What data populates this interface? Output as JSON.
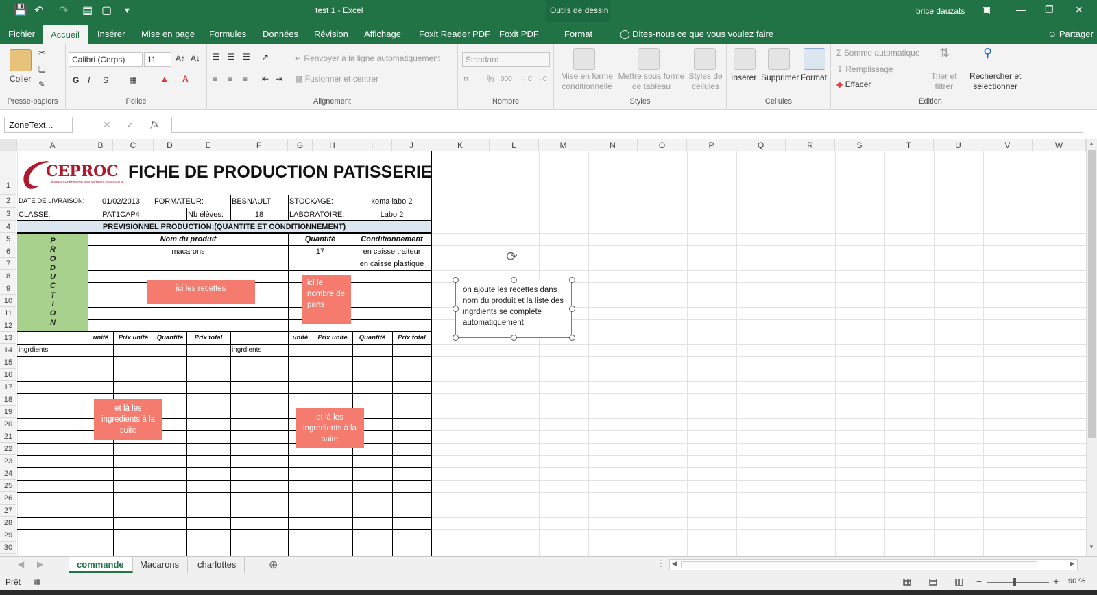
{
  "window": {
    "title": "test 1  -  Excel",
    "context_group": "Outils de dessin",
    "user": "brice dauzats"
  },
  "tabs": [
    "Fichier",
    "Accueil",
    "Insérer",
    "Mise en page",
    "Formules",
    "Données",
    "Révision",
    "Affichage",
    "Foxit Reader PDF",
    "Foxit PDF",
    "Format"
  ],
  "active_tab": "Accueil",
  "tell_me": "Dites-nous ce que vous voulez faire",
  "share": "Partager",
  "ribbon": {
    "clipboard": {
      "paste": "Coller",
      "label": "Presse-papiers"
    },
    "font": {
      "name": "Calibri (Corps)",
      "size": "11",
      "bold": "G",
      "italic": "I",
      "underline": "S",
      "label": "Police"
    },
    "alignment": {
      "wrap": "Renvoyer à la ligne automatiquement",
      "merge": "Fusionner et centrer",
      "label": "Alignement"
    },
    "number": {
      "format": "Standard",
      "percent": "%",
      "thousands": "000",
      "label": "Nombre"
    },
    "styles": {
      "conditional": "Mise en forme\nconditionnelle",
      "table": "Mettre sous forme\nde tableau",
      "cellstyles": "Styles de\ncellules",
      "label": "Styles"
    },
    "cells": {
      "insert": "Insérer",
      "delete": "Supprimer",
      "format": "Format",
      "label": "Cellules"
    },
    "editing": {
      "autosum": "Somme automatique",
      "fill": "Remplissage",
      "clear": "Effacer",
      "sort": "Trier et\nfiltrer",
      "find": "Rechercher et\nsélectionner",
      "label": "Édition"
    }
  },
  "namebox": "ZoneText...",
  "fx": "fx",
  "columns": [
    "A",
    "B",
    "C",
    "D",
    "E",
    "F",
    "G",
    "H",
    "I",
    "J",
    "K",
    "L",
    "M",
    "N",
    "O",
    "P",
    "Q",
    "R",
    "S",
    "T",
    "U",
    "V",
    "W"
  ],
  "rows": [
    "1",
    "2",
    "3",
    "4",
    "5",
    "6",
    "7",
    "8",
    "9",
    "10",
    "11",
    "12",
    "13",
    "14",
    "15",
    "16",
    "17",
    "18",
    "19",
    "20",
    "21",
    "22",
    "23",
    "24",
    "25",
    "26",
    "27",
    "28",
    "29",
    "30"
  ],
  "sheet": {
    "logo": "CEPROC",
    "logo_sub": "ÉCOLE SUPÉRIEURE DES MÉTIERS DE BOUCHE",
    "title": "FICHE DE PRODUCTION PATISSERIE",
    "date_label": "DATE DE LIVRAISON:",
    "date": "01/02/2013",
    "trainer_label": "FORMATEUR:",
    "trainer": "BESNAULT",
    "storage_label": "STOCKAGE:",
    "storage": "koma labo 2",
    "class_label": "CLASSE:",
    "class": "PAT1CAP4",
    "students_label": "Nb élèves:",
    "students": "18",
    "lab_label": "LABORATOIRE:",
    "lab": "Labo 2",
    "forecast": "PREVISIONNEL PRODUCTION:(QUANTITE ET CONDITIONNEMENT)",
    "production_letters": [
      "P",
      "R",
      "O",
      "D",
      "U",
      "C",
      "T",
      "I",
      "O",
      "N"
    ],
    "col_product": "Nom du produit",
    "col_qty": "Quantité",
    "col_pack": "Conditionnement",
    "product1": "macarons",
    "qty1": "17",
    "pack1": "en caisse traiteur",
    "pack2": "en caisse plastique",
    "ing_headers": [
      "unité",
      "Prix unité",
      "Quantité",
      "Prix total"
    ],
    "ingredients_label": "ingrdients"
  },
  "notes": {
    "recipes": "ici les recettes",
    "parts": "ici le nombre de parts",
    "ing_left": "et là  les ingredients à la suite",
    "ing_right": "et là  les ingredients à la suite"
  },
  "textbox": "on ajoute les recettes dans nom du produit et la liste des ingrdients se complète automatiquement",
  "sheet_tabs": [
    "commande",
    "Macarons",
    "charlottes"
  ],
  "active_sheet": "commande",
  "status": {
    "ready": "Prêt",
    "zoom": "90 %"
  },
  "colors": {
    "excel_green": "#217346",
    "note": "#f47b6e",
    "production_green": "#a9d18e",
    "header_blue": "#dce6f1"
  }
}
